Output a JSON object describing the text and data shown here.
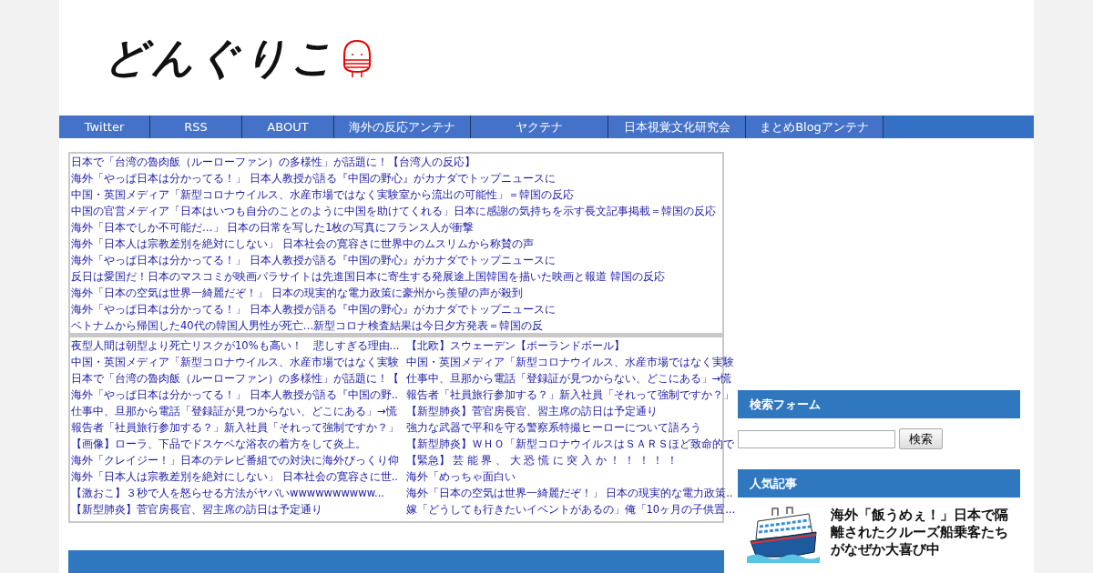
{
  "header": {
    "logo": "どんぐりこ"
  },
  "nav": [
    "Twitter",
    "RSS",
    "ABOUT",
    "海外の反応アンテナ",
    "ヤクテナ",
    "日本視覚文化研究会",
    "まとめBlogアンテナ"
  ],
  "feed": [
    "日本で「台湾の魯肉飯（ルーローファン）の多様性」が話題に！【台湾人の反応】",
    "海外「やっぱ日本は分かってる！」 日本人教授が語る『中国の野心』がカナダでトップニュースに",
    "中国・英国メディア「新型コロナウイルス、水産市場ではなく実験室から流出の可能性」＝韓国の反応",
    "中国の官営メディア「日本はいつも自分のことのように中国を助けてくれる」日本に感謝の気持ちを示す長文記事掲載＝韓国の反応",
    "海外「日本でしか不可能だ…」 日本の日常を写した1枚の写真にフランス人が衝撃",
    "海外「日本人は宗教差別を絶対にしない」 日本社会の寛容さに世界中のムスリムから称賛の声",
    "海外「やっぱ日本は分かってる！」 日本人教授が語る『中国の野心』がカナダでトップニュースに",
    "反日は愛国だ！日本のマスコミが映画パラサイトは先進国日本に寄生する発展途上国韓国を描いた映画と報道 韓国の反応",
    "海外「日本の空気は世界一綺麗だぞ！」 日本の現実的な電力政策に豪州から羨望の声が殺到",
    "海外「やっぱ日本は分かってる！」 日本人教授が語る『中国の野心』がカナダでトップニュースに",
    "ベトナムから帰国した40代の韓国人男性が死亡…新型コロナ検査結果は今日夕方発表＝韓国の反"
  ],
  "links_left": [
    "夜型人間は朝型より死亡リスクが10%も高い！　悲しすぎる理由...",
    "中国・英国メディア「新型コロナウイルス、水産市場ではなく実験",
    "日本で「台湾の魯肉飯（ルーローファン）の多様性」が話題に！【",
    "海外「やっぱ日本は分かってる！」 日本人教授が語る『中国の野..",
    "仕事中、旦那から電話「登録証が見つからない、どこにある」→慌",
    "報告者「社員旅行参加する？」新入社員「それって強制ですか？」",
    "【画像】ローラ、下品でドスケベな浴衣の着方をして炎上。",
    "海外「クレイジー！」日本のテレビ番組での対決に海外びっくり仰",
    "海外「日本人は宗教差別を絶対にしない」 日本社会の寛容さに世..",
    "【激おこ】３秒で人を怒らせる方法がヤバいwwwwwwwwww...",
    "【新型肺炎】菅官房長官、習主席の訪日は予定通り"
  ],
  "links_right": [
    "【北欧】スウェーデン【ポーランドボール】",
    "中国・英国メディア「新型コロナウイルス、水産市場ではなく実験",
    "仕事中、旦那から電話「登録証が見つからない、どこにある」→慌",
    "報告者「社員旅行参加する？」新入社員「それって強制ですか？」",
    "【新型肺炎】菅官房長官、習主席の訪日は予定通り",
    "強力な武器で平和を守る警察系特撮ヒーローについて語ろう",
    "【新型肺炎】ＷＨＯ「新型コロナウイルスはＳＡＲＳほど致命的で",
    "【緊急】 芸 能 界 、 大 恐 慌 に 突 入 か ！ ！ ！ ！ ！",
    "海外「めっちゃ面白い",
    "海外「日本の空気は世界一綺麗だぞ！」 日本の現実的な電力政策..",
    "嫁「どうしても行きたいイベントがあるの」俺「10ヶ月の子供置..."
  ],
  "sidebar": {
    "search_title": "検索フォーム",
    "search_button": "検索",
    "popular_title": "人気記事",
    "popular": [
      {
        "title": "海外「飯うめぇ！」日本で隔離されたクルーズ船乗客たちがなぜか大喜び中"
      }
    ]
  }
}
